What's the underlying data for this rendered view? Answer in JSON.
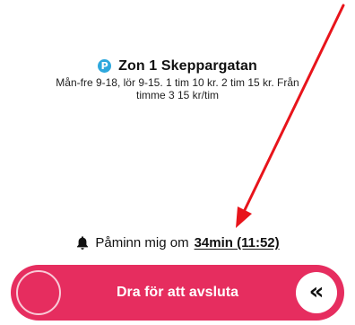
{
  "zone": {
    "title": "Zon 1 Skeppargatan",
    "parking_icon": "P",
    "description": "Mån-fre 9-18, lör 9-15. 1 tim 10 kr. 2 tim 15 kr. Från timme 3 15 kr/tim"
  },
  "reminder": {
    "label": "Påminn mig om",
    "time": "34min (11:52)",
    "icon": "bell-icon"
  },
  "slide_action": {
    "label": "Dra för att avsluta",
    "handle_glyph": "«",
    "handle_icon": "double-chevron-left-icon"
  },
  "colors": {
    "accent": "#e62d5f",
    "parking_icon": "#2ea8dd",
    "annotation": "#e8141b"
  }
}
